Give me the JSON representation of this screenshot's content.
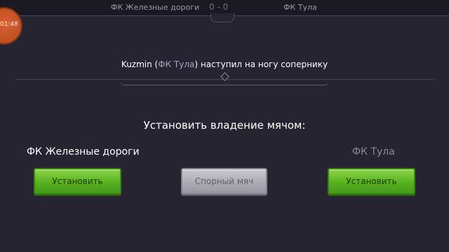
{
  "top_bar": {
    "home_team": "ФК Железные дороги",
    "score": "0 - 0",
    "away_team": "ФК Тула"
  },
  "timer": "01:48",
  "event": {
    "player": "Kuzmin",
    "team": "ФК Тула",
    "action": "наступил на ногу сопернику"
  },
  "prompt": "Установить владение мячом:",
  "teams": {
    "home": "ФК Железные дороги",
    "away": "ФК Тула"
  },
  "buttons": {
    "set_home": "Установить",
    "jump_ball": "Спорный мяч",
    "set_away": "Установить"
  }
}
